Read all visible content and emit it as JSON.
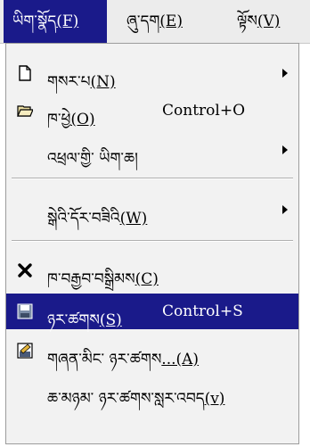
{
  "menubar": {
    "items": [
      {
        "text": "ཡིག་སྣོད",
        "mnemonic": "(F)"
      },
      {
        "text": "ཞུ་དག",
        "mnemonic": "(E)"
      },
      {
        "text": "ལྟོས",
        "mnemonic": "(V)"
      }
    ]
  },
  "menu": {
    "items": [
      {
        "text": "གསར་པ",
        "mnemonic": "(N)",
        "accel": "",
        "icon": "new-file-icon"
      },
      {
        "text": "ཁ་ཕྱེ",
        "mnemonic": "(O)",
        "accel": "Control+O",
        "icon": "open-folder-icon"
      },
      {
        "text": "འཕྲལ་གྱི་ ཡིག་ཆ།",
        "mnemonic": "",
        "accel": ""
      },
      {
        "text": "སྒེའི་དོར་བཟིའི",
        "mnemonic": "(W)",
        "accel": ""
      },
      {
        "text": "ཁ་བརྒྱབ་བསྒྲིམས",
        "mnemonic": "(C)",
        "accel": "",
        "icon": "close-x-icon"
      },
      {
        "text": "ཉར་ཚགས",
        "mnemonic": "(S)",
        "accel": "Control+S",
        "icon": "save-disk-icon"
      },
      {
        "text": "གཞན་མིང་ ཉར་ཚགས",
        "mnemonic": "...(A)",
        "accel": "",
        "icon": "save-as-icon"
      },
      {
        "text": "ཆ་མཉམ་ ཉར་ཚགས་སླར་འབད",
        "mnemonic": "(v)",
        "accel": ""
      }
    ]
  }
}
